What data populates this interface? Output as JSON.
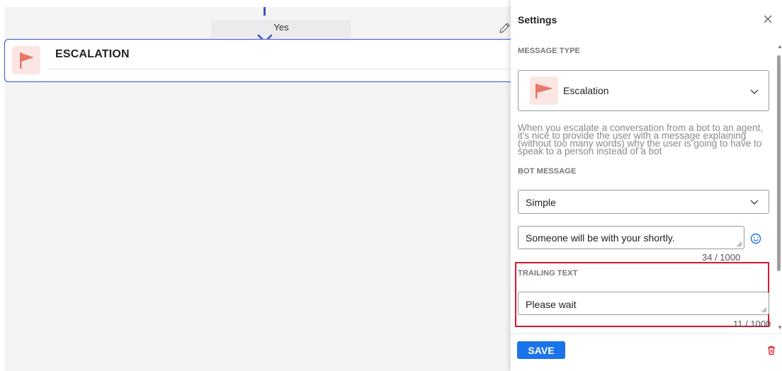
{
  "canvas": {
    "branch_label": "Yes",
    "node": {
      "title": "ESCALATION",
      "icon": "flag-icon"
    },
    "edit_icon": "pencil-icon"
  },
  "settings": {
    "title": "Settings",
    "close_icon": "close-icon",
    "message_type": {
      "label": "MESSAGE TYPE",
      "selected": "Escalation",
      "icon": "flag-icon"
    },
    "help_text": "When you escalate a conversation from a bot to an agent, it's nice to provide the user with a message explaining (without too many words) why the user is going to have to speak to a person instead of a bot",
    "bot_message": {
      "label": "BOT MESSAGE",
      "mode": "Simple",
      "text": "Someone will be with your shortly.",
      "count": "34 / 1000",
      "emoji_icon": "emoji-icon"
    },
    "trailing_text": {
      "label": "TRAILING TEXT",
      "text": "Please wait",
      "count": "11 / 1000"
    },
    "save_label": "SAVE",
    "delete_icon": "trash-icon"
  },
  "colors": {
    "accent": "#3b52c6",
    "save_button": "#1a73e8",
    "flag": "#e8776c",
    "flag_bg": "#fbe6e3",
    "highlight": "#d9162b",
    "delete": "#d9162b"
  }
}
